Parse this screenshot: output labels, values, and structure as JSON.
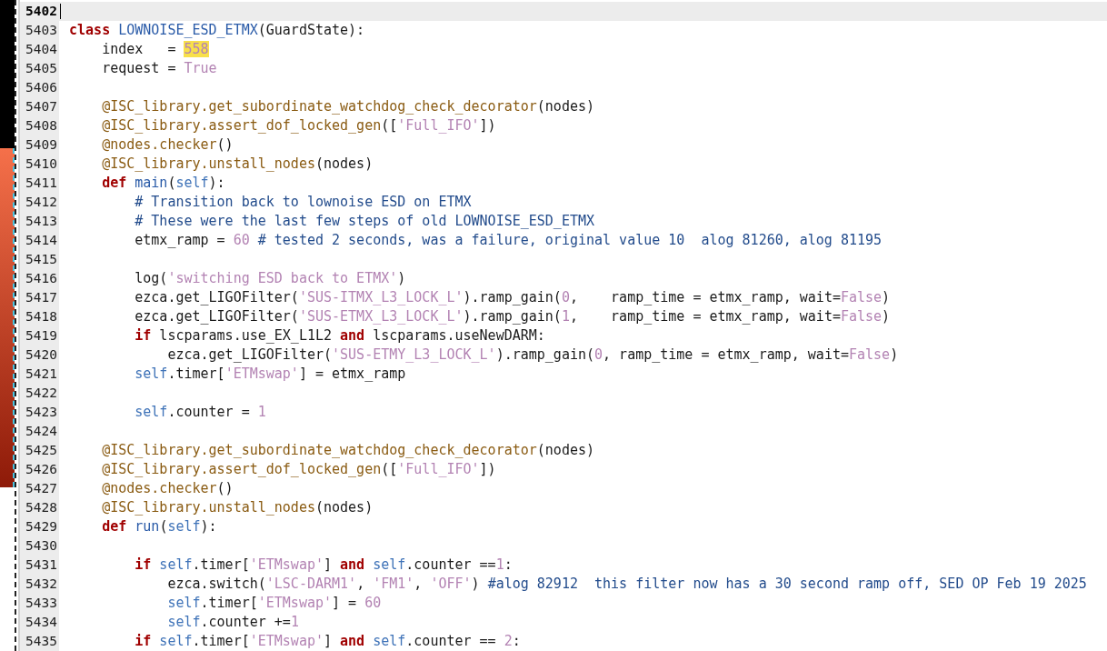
{
  "editor": {
    "lines": [
      {
        "number": "5402",
        "current": true
      },
      {
        "number": "5403",
        "current": false,
        "tokens": [
          {
            "kind": "keyword",
            "text": "class"
          },
          {
            "kind": "classname",
            "text": " LOWNOISE_ESD_ETMX"
          },
          {
            "kind": "plain",
            "text": "(GuardState):"
          }
        ]
      },
      {
        "number": "5404",
        "current": false,
        "tokens": [
          {
            "kind": "plain",
            "text": "    index   = "
          },
          {
            "kind": "number",
            "text": "558",
            "highlighted": true
          }
        ]
      },
      {
        "number": "5405",
        "current": false,
        "tokens": [
          {
            "kind": "plain",
            "text": "    request = "
          },
          {
            "kind": "number",
            "text": "True"
          }
        ]
      },
      {
        "number": "5406",
        "current": false
      },
      {
        "number": "5407",
        "current": false,
        "tokens": [
          {
            "kind": "decorator",
            "text": "    @ISC_library.get_subordinate_watchdog_check_decorator"
          },
          {
            "kind": "plain",
            "text": "(nodes)"
          }
        ]
      },
      {
        "number": "5408",
        "current": false,
        "tokens": [
          {
            "kind": "decorator",
            "text": "    @ISC_library.assert_dof_locked_gen"
          },
          {
            "kind": "plain",
            "text": "(["
          },
          {
            "kind": "string",
            "text": "'Full_IFO'"
          },
          {
            "kind": "plain",
            "text": "])"
          }
        ]
      },
      {
        "number": "5409",
        "current": false,
        "tokens": [
          {
            "kind": "decorator",
            "text": "    @nodes.checker"
          },
          {
            "kind": "plain",
            "text": "()"
          }
        ]
      },
      {
        "number": "5410",
        "current": false,
        "tokens": [
          {
            "kind": "decorator",
            "text": "    @ISC_library.unstall_nodes"
          },
          {
            "kind": "plain",
            "text": "(nodes)"
          }
        ]
      },
      {
        "number": "5411",
        "current": false,
        "tokens": [
          {
            "kind": "keyword",
            "text": "    def"
          },
          {
            "kind": "function",
            "text": " main"
          },
          {
            "kind": "plain",
            "text": "("
          },
          {
            "kind": "self",
            "text": "self"
          },
          {
            "kind": "plain",
            "text": "):"
          }
        ]
      },
      {
        "number": "5412",
        "current": false,
        "tokens": [
          {
            "kind": "comment",
            "text": "        # Transition back to lownoise ESD on ETMX"
          }
        ]
      },
      {
        "number": "5413",
        "current": false,
        "tokens": [
          {
            "kind": "comment",
            "text": "        # These were the last few steps of old LOWNOISE_ESD_ETMX"
          }
        ]
      },
      {
        "number": "5414",
        "current": false,
        "tokens": [
          {
            "kind": "plain",
            "text": "        etmx_ramp = "
          },
          {
            "kind": "number",
            "text": "60"
          },
          {
            "kind": "comment",
            "text": " # tested 2 seconds, was a failure, original value 10  alog 81260, alog 81195"
          }
        ]
      },
      {
        "number": "5415",
        "current": false
      },
      {
        "number": "5416",
        "current": false,
        "tokens": [
          {
            "kind": "plain",
            "text": "        log("
          },
          {
            "kind": "string",
            "text": "'switching ESD back to ETMX'"
          },
          {
            "kind": "plain",
            "text": ")"
          }
        ]
      },
      {
        "number": "5417",
        "current": false,
        "tokens": [
          {
            "kind": "plain",
            "text": "        ezca.get_LIGOFilter("
          },
          {
            "kind": "string",
            "text": "'SUS-ITMX_L3_LOCK_L'"
          },
          {
            "kind": "plain",
            "text": ").ramp_gain("
          },
          {
            "kind": "number",
            "text": "0"
          },
          {
            "kind": "plain",
            "text": ",    ramp_time = etmx_ramp, wait="
          },
          {
            "kind": "number",
            "text": "False"
          },
          {
            "kind": "plain",
            "text": ")"
          }
        ]
      },
      {
        "number": "5418",
        "current": false,
        "tokens": [
          {
            "kind": "plain",
            "text": "        ezca.get_LIGOFilter("
          },
          {
            "kind": "string",
            "text": "'SUS-ETMX_L3_LOCK_L'"
          },
          {
            "kind": "plain",
            "text": ").ramp_gain("
          },
          {
            "kind": "number",
            "text": "1"
          },
          {
            "kind": "plain",
            "text": ",    ramp_time = etmx_ramp, wait="
          },
          {
            "kind": "number",
            "text": "False"
          },
          {
            "kind": "plain",
            "text": ")"
          }
        ]
      },
      {
        "number": "5419",
        "current": false,
        "tokens": [
          {
            "kind": "keyword",
            "text": "        if"
          },
          {
            "kind": "plain",
            "text": " lscparams.use_EX_L1L2 "
          },
          {
            "kind": "keyword",
            "text": "and"
          },
          {
            "kind": "plain",
            "text": " lscparams.useNewDARM:"
          }
        ]
      },
      {
        "number": "5420",
        "current": false,
        "tokens": [
          {
            "kind": "plain",
            "text": "            ezca.get_LIGOFilter("
          },
          {
            "kind": "string",
            "text": "'SUS-ETMY_L3_LOCK_L'"
          },
          {
            "kind": "plain",
            "text": ").ramp_gain("
          },
          {
            "kind": "number",
            "text": "0"
          },
          {
            "kind": "plain",
            "text": ", ramp_time = etmx_ramp, wait="
          },
          {
            "kind": "number",
            "text": "False"
          },
          {
            "kind": "plain",
            "text": ")"
          }
        ]
      },
      {
        "number": "5421",
        "current": false,
        "tokens": [
          {
            "kind": "self",
            "text": "        self"
          },
          {
            "kind": "plain",
            "text": ".timer["
          },
          {
            "kind": "string",
            "text": "'ETMswap'"
          },
          {
            "kind": "plain",
            "text": "] = etmx_ramp"
          }
        ]
      },
      {
        "number": "5422",
        "current": false
      },
      {
        "number": "5423",
        "current": false,
        "tokens": [
          {
            "kind": "self",
            "text": "        self"
          },
          {
            "kind": "plain",
            "text": ".counter = "
          },
          {
            "kind": "number",
            "text": "1"
          }
        ]
      },
      {
        "number": "5424",
        "current": false
      },
      {
        "number": "5425",
        "current": false,
        "tokens": [
          {
            "kind": "decorator",
            "text": "    @ISC_library.get_subordinate_watchdog_check_decorator"
          },
          {
            "kind": "plain",
            "text": "(nodes)"
          }
        ]
      },
      {
        "number": "5426",
        "current": false,
        "tokens": [
          {
            "kind": "decorator",
            "text": "    @ISC_library.assert_dof_locked_gen"
          },
          {
            "kind": "plain",
            "text": "(["
          },
          {
            "kind": "string",
            "text": "'Full_IFO'"
          },
          {
            "kind": "plain",
            "text": "])"
          }
        ]
      },
      {
        "number": "5427",
        "current": false,
        "tokens": [
          {
            "kind": "decorator",
            "text": "    @nodes.checker"
          },
          {
            "kind": "plain",
            "text": "()"
          }
        ]
      },
      {
        "number": "5428",
        "current": false,
        "tokens": [
          {
            "kind": "decorator",
            "text": "    @ISC_library.unstall_nodes"
          },
          {
            "kind": "plain",
            "text": "(nodes)"
          }
        ]
      },
      {
        "number": "5429",
        "current": false,
        "tokens": [
          {
            "kind": "keyword",
            "text": "    def"
          },
          {
            "kind": "function",
            "text": " run"
          },
          {
            "kind": "plain",
            "text": "("
          },
          {
            "kind": "self",
            "text": "self"
          },
          {
            "kind": "plain",
            "text": "):"
          }
        ]
      },
      {
        "number": "5430",
        "current": false
      },
      {
        "number": "5431",
        "current": false,
        "tokens": [
          {
            "kind": "keyword",
            "text": "        if"
          },
          {
            "kind": "self",
            "text": " self"
          },
          {
            "kind": "plain",
            "text": ".timer["
          },
          {
            "kind": "string",
            "text": "'ETMswap'"
          },
          {
            "kind": "plain",
            "text": "] "
          },
          {
            "kind": "keyword",
            "text": "and"
          },
          {
            "kind": "self",
            "text": " self"
          },
          {
            "kind": "plain",
            "text": ".counter =="
          },
          {
            "kind": "number",
            "text": "1"
          },
          {
            "kind": "plain",
            "text": ":"
          }
        ]
      },
      {
        "number": "5432",
        "current": false,
        "tokens": [
          {
            "kind": "plain",
            "text": "            ezca.switch("
          },
          {
            "kind": "string",
            "text": "'LSC-DARM1'"
          },
          {
            "kind": "plain",
            "text": ", "
          },
          {
            "kind": "string",
            "text": "'FM1'"
          },
          {
            "kind": "plain",
            "text": ", "
          },
          {
            "kind": "string",
            "text": "'OFF'"
          },
          {
            "kind": "plain",
            "text": ") "
          },
          {
            "kind": "comment",
            "text": "#alog 82912  this filter now has a 30 second ramp off, SED OP Feb 19 2025"
          }
        ]
      },
      {
        "number": "5433",
        "current": false,
        "tokens": [
          {
            "kind": "self",
            "text": "            self"
          },
          {
            "kind": "plain",
            "text": ".timer["
          },
          {
            "kind": "string",
            "text": "'ETMswap'"
          },
          {
            "kind": "plain",
            "text": "] = "
          },
          {
            "kind": "number",
            "text": "60"
          }
        ]
      },
      {
        "number": "5434",
        "current": false,
        "tokens": [
          {
            "kind": "self",
            "text": "            self"
          },
          {
            "kind": "plain",
            "text": ".counter +="
          },
          {
            "kind": "number",
            "text": "1"
          }
        ]
      },
      {
        "number": "5435",
        "current": false,
        "tokens": [
          {
            "kind": "keyword",
            "text": "        if"
          },
          {
            "kind": "self",
            "text": " self"
          },
          {
            "kind": "plain",
            "text": ".timer["
          },
          {
            "kind": "string",
            "text": "'ETMswap'"
          },
          {
            "kind": "plain",
            "text": "] "
          },
          {
            "kind": "keyword",
            "text": "and"
          },
          {
            "kind": "self",
            "text": " self"
          },
          {
            "kind": "plain",
            "text": ".counter == "
          },
          {
            "kind": "number",
            "text": "2"
          },
          {
            "kind": "plain",
            "text": ":"
          }
        ]
      }
    ]
  }
}
